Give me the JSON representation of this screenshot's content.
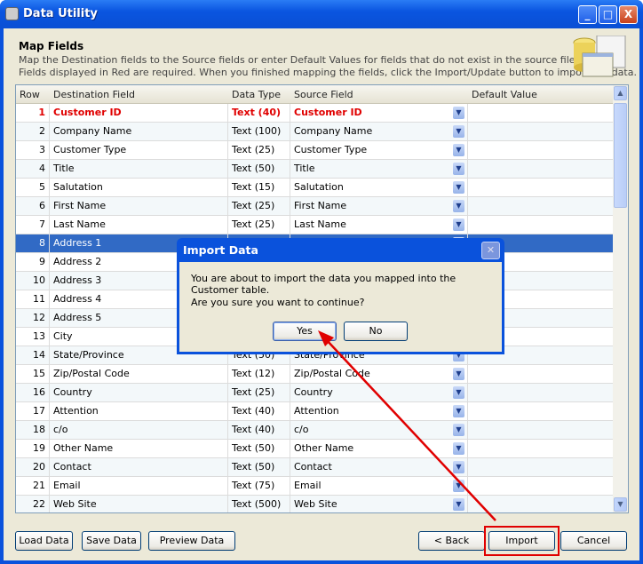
{
  "window": {
    "title": "Data Utility",
    "minimize": "_",
    "maximize": "□",
    "close": "X"
  },
  "header": {
    "title": "Map Fields",
    "line1": "Map the Destination fields to the Source fields or enter Default Values for fields that do not exist in the source file.",
    "line2": "Fields displayed in Red are required.  When you finished mapping the fields, click the Import/Update button to import the data."
  },
  "grid": {
    "columns": [
      "Row",
      "Destination Field",
      "Data Type",
      "Source Field",
      "Default Value"
    ],
    "selected_row": 8,
    "rows": [
      {
        "row": "1",
        "dest": "Customer ID",
        "type": "Text (40)",
        "source": "Customer ID",
        "default": "",
        "required": true
      },
      {
        "row": "2",
        "dest": "Company Name",
        "type": "Text (100)",
        "source": "Company Name",
        "default": ""
      },
      {
        "row": "3",
        "dest": "Customer Type",
        "type": "Text (25)",
        "source": "Customer Type",
        "default": ""
      },
      {
        "row": "4",
        "dest": "Title",
        "type": "Text (50)",
        "source": "Title",
        "default": ""
      },
      {
        "row": "5",
        "dest": "Salutation",
        "type": "Text (15)",
        "source": "Salutation",
        "default": ""
      },
      {
        "row": "6",
        "dest": "First Name",
        "type": "Text (25)",
        "source": "First Name",
        "default": ""
      },
      {
        "row": "7",
        "dest": "Last Name",
        "type": "Text (25)",
        "source": "Last Name",
        "default": ""
      },
      {
        "row": "8",
        "dest": "Address 1",
        "type": "",
        "source": "",
        "default": ""
      },
      {
        "row": "9",
        "dest": "Address 2",
        "type": "",
        "source": "",
        "default": ""
      },
      {
        "row": "10",
        "dest": "Address 3",
        "type": "",
        "source": "",
        "default": ""
      },
      {
        "row": "11",
        "dest": "Address 4",
        "type": "",
        "source": "",
        "default": ""
      },
      {
        "row": "12",
        "dest": "Address 5",
        "type": "",
        "source": "",
        "default": ""
      },
      {
        "row": "13",
        "dest": "City",
        "type": "",
        "source": "",
        "default": ""
      },
      {
        "row": "14",
        "dest": "State/Province",
        "type": "Text (50)",
        "source": "State/Province",
        "default": ""
      },
      {
        "row": "15",
        "dest": "Zip/Postal Code",
        "type": "Text (12)",
        "source": "Zip/Postal Code",
        "default": ""
      },
      {
        "row": "16",
        "dest": "Country",
        "type": "Text (25)",
        "source": "Country",
        "default": ""
      },
      {
        "row": "17",
        "dest": "Attention",
        "type": "Text (40)",
        "source": "Attention",
        "default": ""
      },
      {
        "row": "18",
        "dest": "c/o",
        "type": "Text (40)",
        "source": "c/o",
        "default": ""
      },
      {
        "row": "19",
        "dest": "Other Name",
        "type": "Text (50)",
        "source": "Other Name",
        "default": ""
      },
      {
        "row": "20",
        "dest": "Contact",
        "type": "Text (50)",
        "source": "Contact",
        "default": ""
      },
      {
        "row": "21",
        "dest": "Email",
        "type": "Text (75)",
        "source": "Email",
        "default": ""
      },
      {
        "row": "22",
        "dest": "Web Site",
        "type": "Text (500)",
        "source": "Web Site",
        "default": ""
      }
    ]
  },
  "buttons": {
    "load": "Load Data",
    "save": "Save Data",
    "preview": "Preview Data",
    "back": "< Back",
    "import": "Import",
    "cancel": "Cancel"
  },
  "dialog": {
    "title": "Import Data",
    "message": "You are about to import the data you mapped into the  Customer table.",
    "question": "Are you sure you want to continue?",
    "yes": "Yes",
    "no": "No"
  },
  "colors": {
    "required": "#e00000",
    "selection": "#316ac5",
    "annotation": "#e00000"
  }
}
